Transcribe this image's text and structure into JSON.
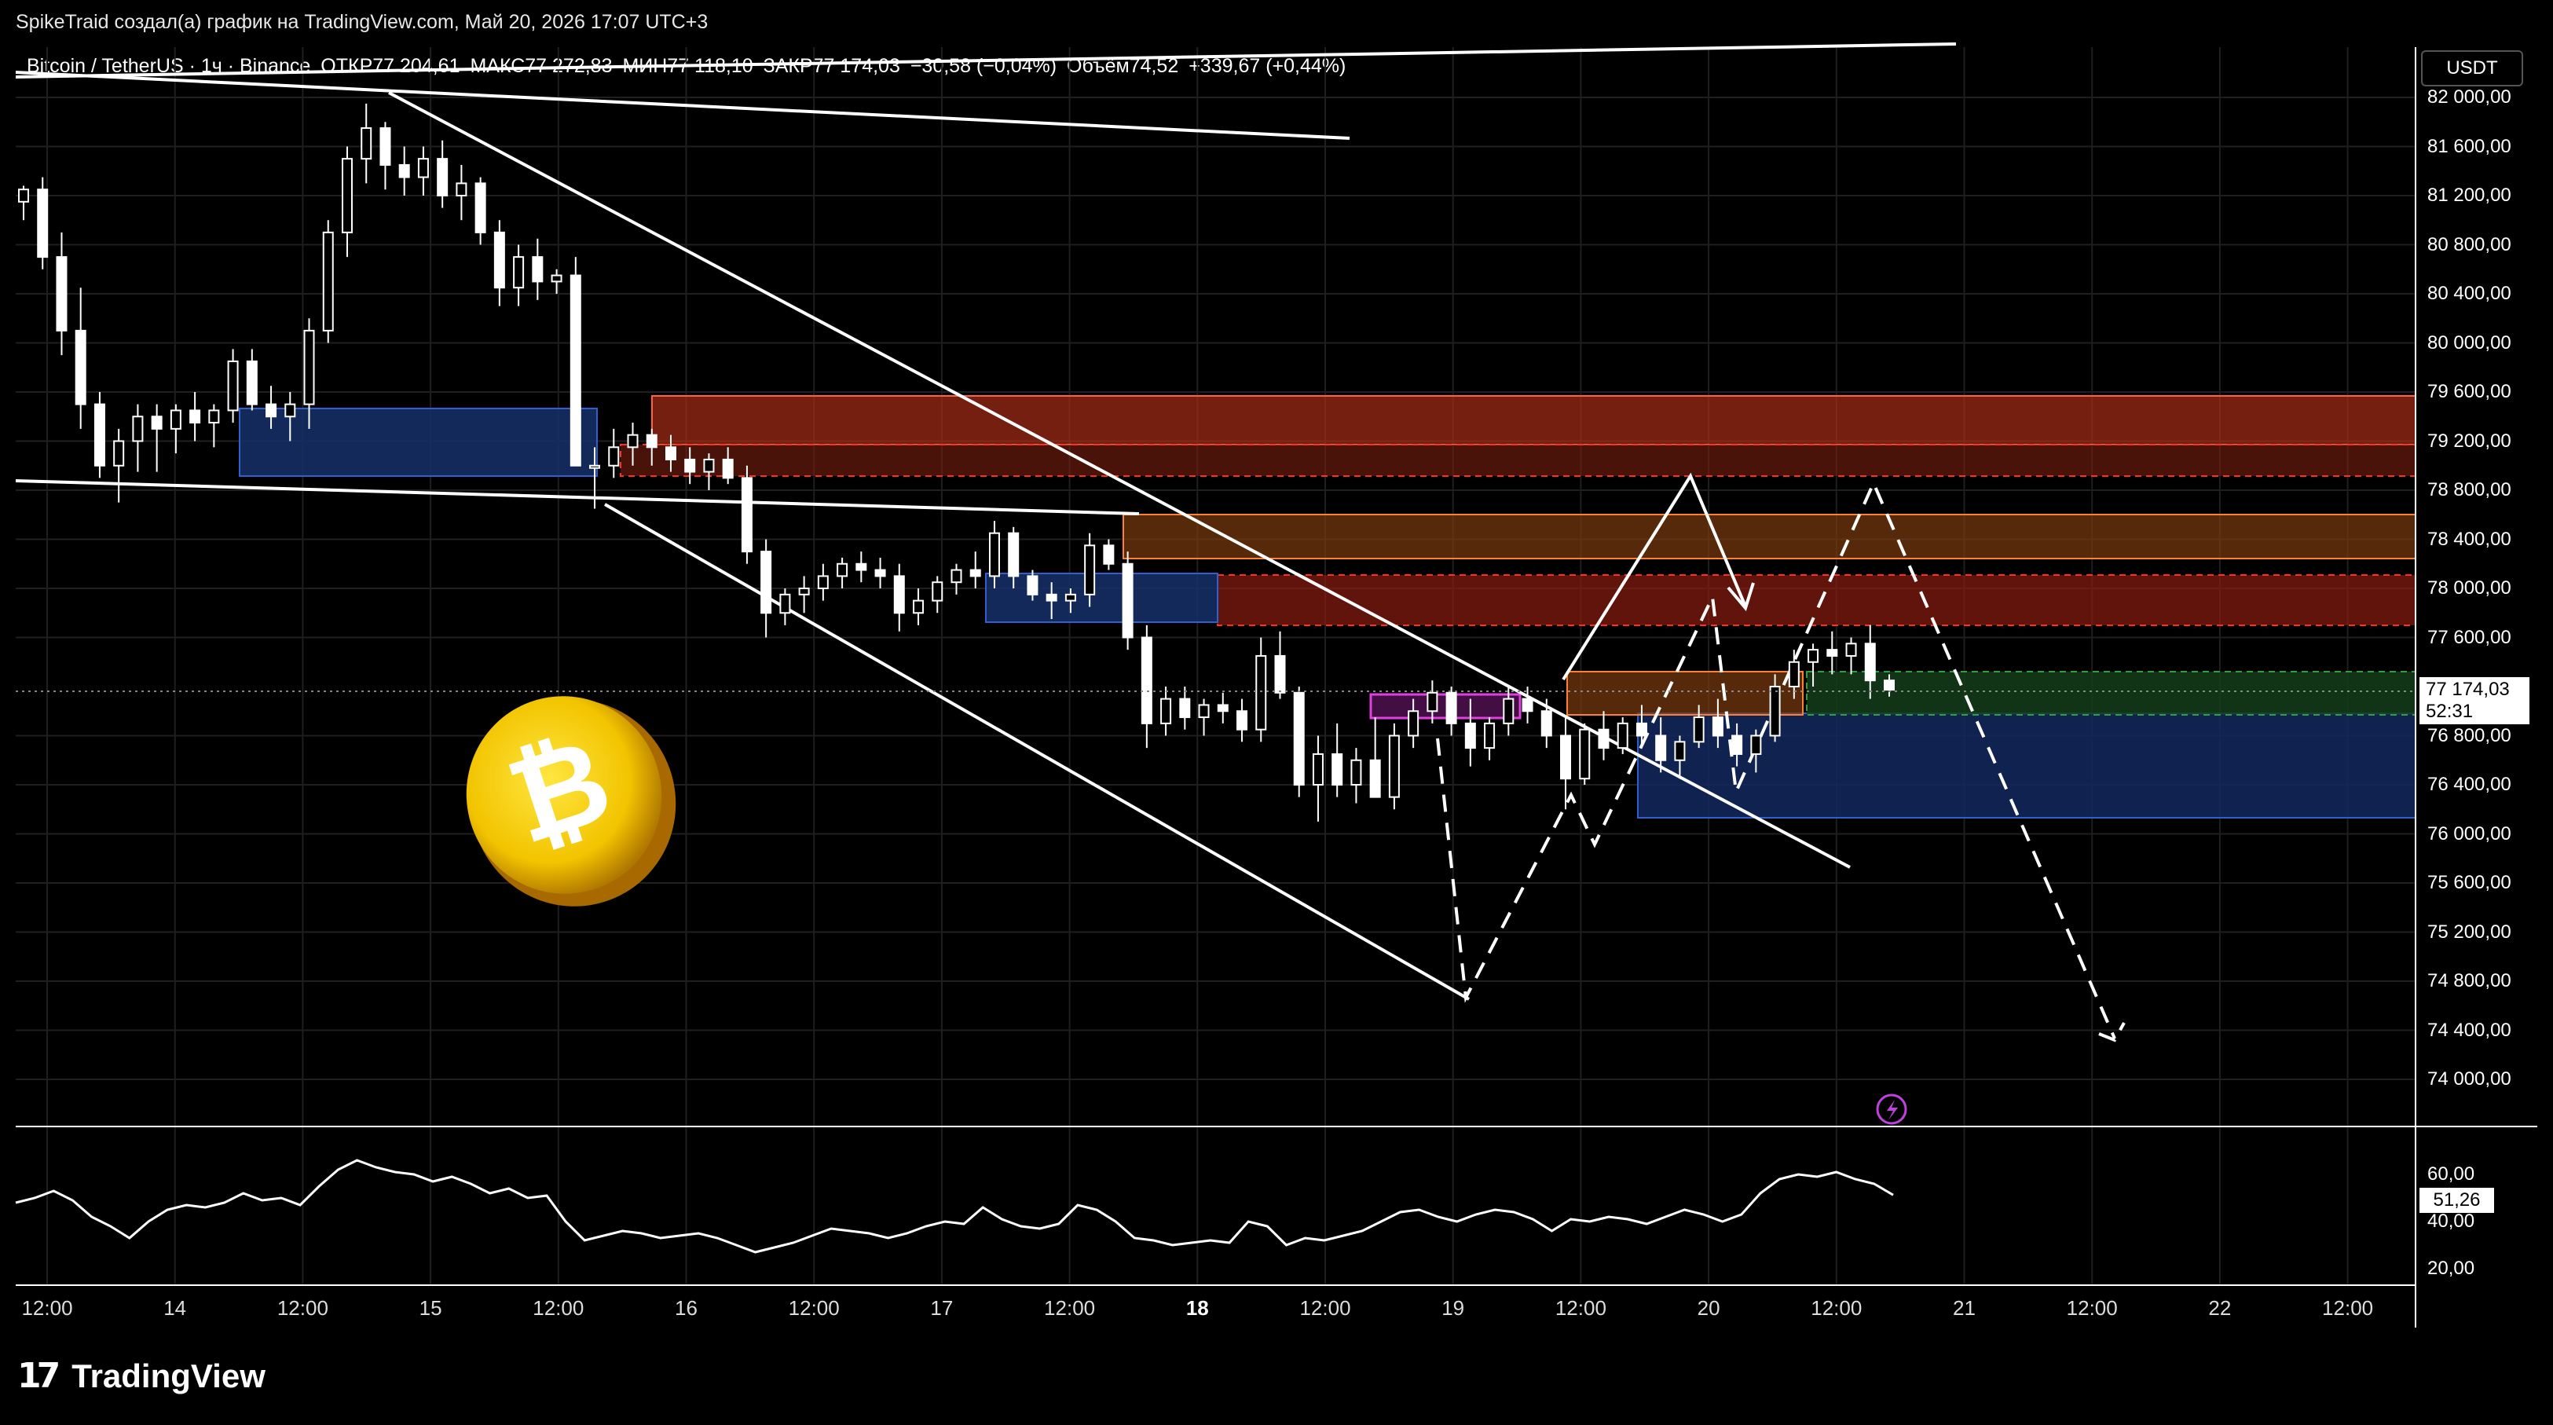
{
  "header": "SpikeTraid создал(а) график на TradingView.com, Май 20, 2026 17:07 UTC+3",
  "legend": {
    "symbol": "Bitcoin / TetherUS · 1ч · Binance",
    "open": "ОТКР77 204,61",
    "high": "МАКС77 272,83",
    "low": "МИН77 118,10",
    "close": "ЗАКР77 174,03",
    "change": "−30,58 (−0,04%)",
    "volume": "Объём74,52",
    "volume_change": "+339,67 (+0,44%)"
  },
  "currency": "USDT",
  "last_price": "77 174,03",
  "countdown": "52:31",
  "rsi_value": "51,26",
  "brand": {
    "logo": "17",
    "name": "TradingView"
  },
  "icons": {
    "coin": "bitcoin-coin-icon",
    "alert": "lightning-alert-icon"
  },
  "colors": {
    "candle": "#ffffff",
    "supply_zone": "#c0301a",
    "demand_zone": "#1c3a8a",
    "fvg_zone": "#c040c0",
    "green_zone": "#1a5a20"
  },
  "chart_data": {
    "type": "candlestick",
    "y_ticks": [
      "82 000,00",
      "81 600,00",
      "81 200,00",
      "80 800,00",
      "80 400,00",
      "80 000,00",
      "79 600,00",
      "79 200,00",
      "78 800,00",
      "78 400,00",
      "78 000,00",
      "77 600,00",
      "76 800,00",
      "76 400,00",
      "76 000,00",
      "75 600,00",
      "75 200,00",
      "74 800,00",
      "74 400,00",
      "74 000,00"
    ],
    "x_ticks": [
      "12:00",
      "14",
      "12:00",
      "15",
      "12:00",
      "16",
      "12:00",
      "17",
      "12:00",
      "18",
      "12:00",
      "19",
      "12:00",
      "20",
      "12:00",
      "21",
      "12:00",
      "22",
      "12:00"
    ],
    "ylim": [
      73600,
      82100
    ],
    "rsi_ticks": [
      "60,00",
      "40,00",
      "20,00"
    ],
    "rsi_lim": [
      15,
      75
    ],
    "candles": [
      [
        81150,
        81280,
        81000,
        81250
      ],
      [
        81250,
        81350,
        80600,
        80700
      ],
      [
        80700,
        80900,
        79900,
        80100
      ],
      [
        80100,
        80450,
        79300,
        79500
      ],
      [
        79500,
        79600,
        78900,
        79000
      ],
      [
        79000,
        79300,
        78700,
        79200
      ],
      [
        79200,
        79500,
        78950,
        79400
      ],
      [
        79400,
        79500,
        78950,
        79300
      ],
      [
        79300,
        79500,
        79100,
        79450
      ],
      [
        79450,
        79600,
        79200,
        79350
      ],
      [
        79350,
        79500,
        79150,
        79450
      ],
      [
        79450,
        79950,
        79350,
        79850
      ],
      [
        79850,
        79950,
        79450,
        79500
      ],
      [
        79500,
        79650,
        79300,
        79400
      ],
      [
        79400,
        79600,
        79200,
        79500
      ],
      [
        79500,
        80200,
        79300,
        80100
      ],
      [
        80100,
        81000,
        80000,
        80900
      ],
      [
        80900,
        81600,
        80700,
        81500
      ],
      [
        81500,
        81950,
        81300,
        81750
      ],
      [
        81750,
        81800,
        81250,
        81450
      ],
      [
        81450,
        81600,
        81200,
        81350
      ],
      [
        81350,
        81600,
        81200,
        81500
      ],
      [
        81500,
        81650,
        81100,
        81200
      ],
      [
        81200,
        81450,
        81000,
        81300
      ],
      [
        81300,
        81350,
        80800,
        80900
      ],
      [
        80900,
        81000,
        80300,
        80450
      ],
      [
        80450,
        80800,
        80300,
        80700
      ],
      [
        80700,
        80850,
        80350,
        80500
      ],
      [
        80500,
        80600,
        80400,
        80550
      ],
      [
        80550,
        80700,
        79300,
        79000
      ],
      [
        79000,
        79150,
        78650,
        79000
      ],
      [
        79000,
        79300,
        78900,
        79150
      ],
      [
        79150,
        79350,
        79000,
        79250
      ],
      [
        79250,
        79300,
        79000,
        79150
      ],
      [
        79150,
        79250,
        78950,
        79050
      ],
      [
        79050,
        79150,
        78850,
        78950
      ],
      [
        78950,
        79100,
        78800,
        79050
      ],
      [
        79050,
        79150,
        78850,
        78900
      ],
      [
        78900,
        79000,
        78200,
        78300
      ],
      [
        78300,
        78400,
        77600,
        77800
      ],
      [
        77800,
        78000,
        77700,
        77950
      ],
      [
        77950,
        78100,
        77800,
        78000
      ],
      [
        78000,
        78200,
        77900,
        78100
      ],
      [
        78100,
        78250,
        78000,
        78200
      ],
      [
        78200,
        78300,
        78050,
        78150
      ],
      [
        78150,
        78250,
        78000,
        78100
      ],
      [
        78100,
        78200,
        77650,
        77800
      ],
      [
        77800,
        78000,
        77700,
        77900
      ],
      [
        77900,
        78100,
        77800,
        78050
      ],
      [
        78050,
        78200,
        77950,
        78150
      ],
      [
        78150,
        78300,
        78000,
        78100
      ],
      [
        78100,
        78550,
        78000,
        78450
      ],
      [
        78450,
        78500,
        78000,
        78100
      ],
      [
        78100,
        78150,
        77900,
        77950
      ],
      [
        77950,
        78050,
        77750,
        77900
      ],
      [
        77900,
        78000,
        77800,
        77950
      ],
      [
        77950,
        78450,
        77850,
        78350
      ],
      [
        78350,
        78400,
        78150,
        78200
      ],
      [
        78200,
        78300,
        77500,
        77600
      ],
      [
        77600,
        77700,
        76700,
        76900
      ],
      [
        76900,
        77200,
        76800,
        77100
      ],
      [
        77100,
        77200,
        76850,
        76950
      ],
      [
        76950,
        77100,
        76800,
        77050
      ],
      [
        77050,
        77150,
        76900,
        77000
      ],
      [
        77000,
        77100,
        76750,
        76850
      ],
      [
        76850,
        77600,
        76750,
        77450
      ],
      [
        77450,
        77650,
        77100,
        77150
      ],
      [
        77150,
        77200,
        76300,
        76400
      ],
      [
        76400,
        76800,
        76100,
        76650
      ],
      [
        76650,
        76900,
        76300,
        76400
      ],
      [
        76400,
        76700,
        76250,
        76600
      ],
      [
        76600,
        76950,
        76400,
        76300
      ],
      [
        76300,
        76900,
        76200,
        76800
      ],
      [
        76800,
        77100,
        76700,
        77000
      ],
      [
        77000,
        77250,
        76900,
        77150
      ],
      [
        77150,
        77200,
        76800,
        76900
      ],
      [
        76900,
        77100,
        76550,
        76700
      ],
      [
        76700,
        76950,
        76600,
        76900
      ],
      [
        76900,
        77200,
        76800,
        77100
      ],
      [
        77100,
        77200,
        76900,
        77000
      ],
      [
        77000,
        77100,
        76700,
        76800
      ],
      [
        76800,
        76950,
        76200,
        76450
      ],
      [
        76450,
        76900,
        76400,
        76850
      ],
      [
        76850,
        77000,
        76600,
        76700
      ],
      [
        76700,
        76950,
        76650,
        76900
      ],
      [
        76900,
        77050,
        76700,
        76800
      ],
      [
        76800,
        76950,
        76500,
        76600
      ],
      [
        76600,
        76800,
        76450,
        76750
      ],
      [
        76750,
        77050,
        76700,
        76950
      ],
      [
        76950,
        77100,
        76700,
        76800
      ],
      [
        76800,
        76900,
        76550,
        76650
      ],
      [
        76650,
        76850,
        76500,
        76800
      ],
      [
        76800,
        77300,
        76750,
        77200
      ],
      [
        77200,
        77500,
        77100,
        77400
      ],
      [
        77400,
        77550,
        77200,
        77500
      ],
      [
        77500,
        77650,
        77300,
        77450
      ],
      [
        77450,
        77600,
        77300,
        77550
      ],
      [
        77550,
        77700,
        77100,
        77250
      ],
      [
        77250,
        77300,
        77118,
        77174
      ]
    ],
    "rsi": [
      48,
      50,
      53,
      49,
      42,
      38,
      33,
      40,
      45,
      47,
      46,
      48,
      52,
      49,
      50,
      47,
      55,
      62,
      66,
      63,
      61,
      60,
      57,
      59,
      56,
      52,
      54,
      50,
      51,
      40,
      32,
      34,
      36,
      35,
      33,
      34,
      35,
      33,
      30,
      27,
      29,
      31,
      34,
      37,
      36,
      35,
      33,
      35,
      38,
      40,
      39,
      46,
      41,
      38,
      37,
      39,
      47,
      45,
      40,
      33,
      32,
      30,
      31,
      32,
      31,
      40,
      38,
      30,
      33,
      32,
      34,
      36,
      40,
      44,
      45,
      42,
      40,
      43,
      45,
      44,
      41,
      36,
      41,
      40,
      42,
      41,
      39,
      42,
      45,
      43,
      40,
      43,
      52,
      58,
      60,
      59,
      61,
      58,
      56,
      51.26
    ]
  }
}
